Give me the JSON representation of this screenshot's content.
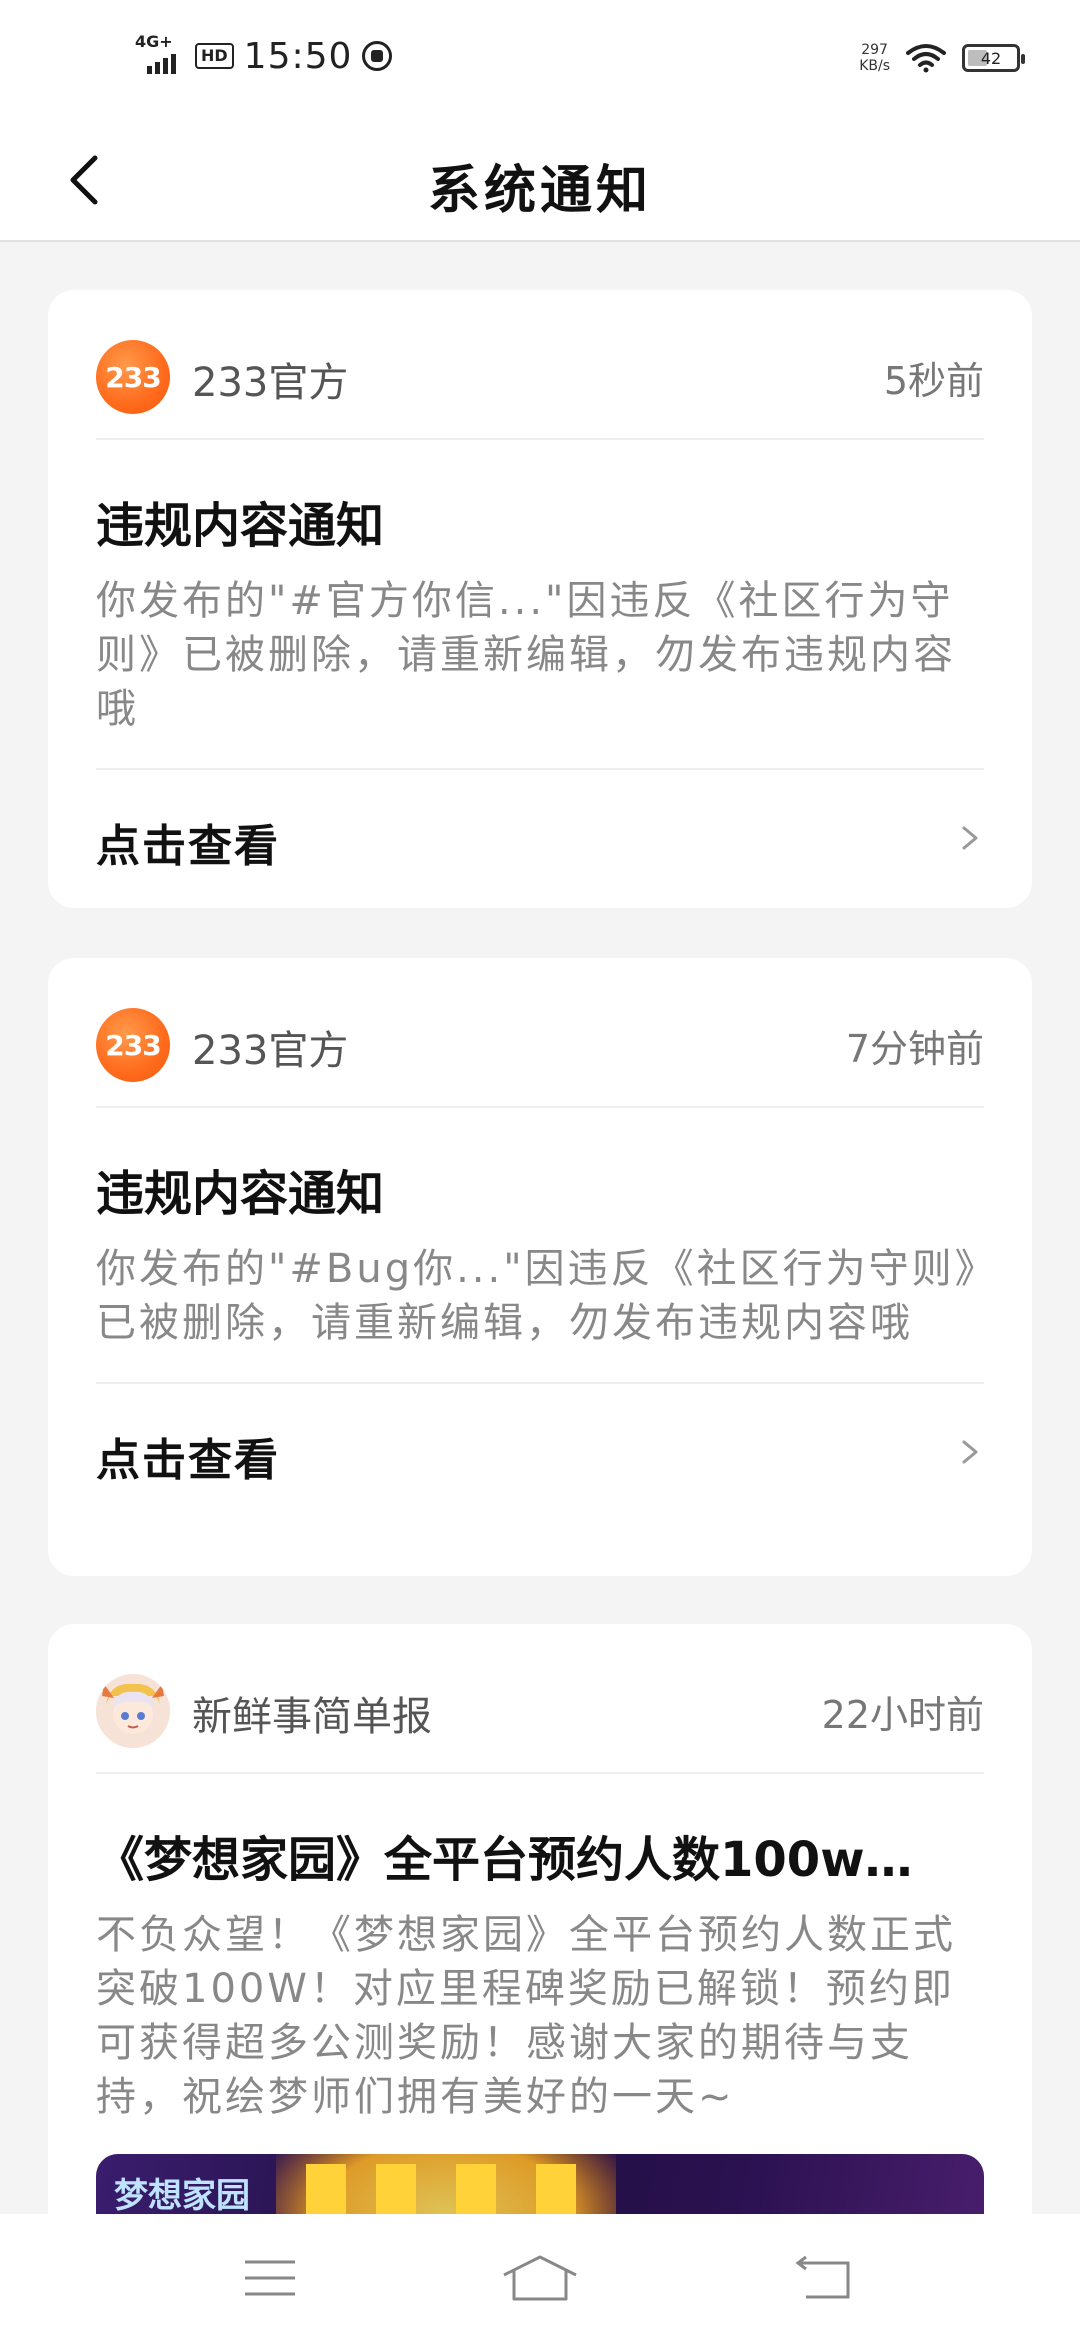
{
  "status_bar": {
    "network": "4G+",
    "hd": "HD",
    "time": "15:50",
    "speed_value": "297",
    "speed_unit": "KB/s",
    "battery": "42",
    "battery_level": 0.42
  },
  "nav": {
    "title": "系统通知"
  },
  "notifications": [
    {
      "sender": "233官方",
      "avatar_text": "233",
      "time": "5秒前",
      "title": "违规内容通知",
      "body": "你发布的\"#官方你信...\"因违反《社区行为守则》已被删除，请重新编辑，勿发布违规内容哦",
      "action": "点击查看"
    },
    {
      "sender": "233官方",
      "avatar_text": "233",
      "time": "7分钟前",
      "title": "违规内容通知",
      "body": "你发布的\"#Bug你...\"因违反《社区行为守则》已被删除，请重新编辑，勿发布违规内容哦",
      "action": "点击查看"
    },
    {
      "sender": "新鲜事简单报",
      "time": "22小时前",
      "title": "《梦想家园》全平台预约人数100w…",
      "body": "不负众望！《梦想家园》全平台预约人数正式突破100W！对应里程碑奖励已解锁！预约即可获得超多公测奖励！感谢大家的期待与支持，祝绘梦师们拥有美好的一天~",
      "banner_logo": "梦想家园"
    }
  ],
  "colors": {
    "accent_orange": "#ff6a1c",
    "background": "#f4f4f4"
  }
}
